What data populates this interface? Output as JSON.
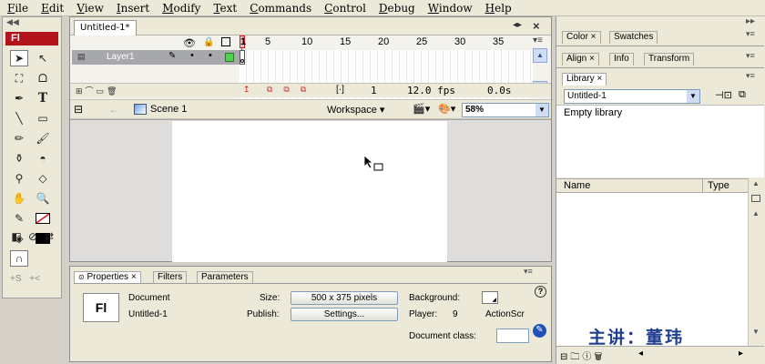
{
  "menubar": {
    "items": [
      "File",
      "Edit",
      "View",
      "Insert",
      "Modify",
      "Text",
      "Commands",
      "Control",
      "Debug",
      "Window",
      "Help"
    ]
  },
  "toolbox": {
    "logo": "Fl",
    "tool_icons": [
      "selection-arrow",
      "subselect-arrow",
      "free-transform",
      "lasso",
      "pen",
      "text",
      "line",
      "rectangle",
      "pencil",
      "brush",
      "ink-bottle",
      "paint-bucket",
      "eyedropper",
      "eraser",
      "hand",
      "zoom",
      "stroke-color",
      "fill-color",
      "black-white",
      "swap-colors",
      "snap-magnet"
    ],
    "snap_label": "+S",
    "arrow_label": "+<"
  },
  "document": {
    "tab_title": "Untitled-1*",
    "timeline": {
      "frame_numbers": [
        "1",
        "5",
        "10",
        "15",
        "20",
        "25",
        "30",
        "35"
      ],
      "layer_name": "Layer1",
      "current_frame": "1",
      "frame_rate": "12.0 fps",
      "elapsed": "0.0s",
      "brackets": "[·]"
    },
    "editbar": {
      "scene": "Scene 1",
      "workspace": "Workspace",
      "zoom": "58%"
    }
  },
  "properties": {
    "tabs": [
      "Properties",
      "Filters",
      "Parameters"
    ],
    "doc_icon_label": "Fl",
    "type_label": "Document",
    "doc_name": "Untitled-1",
    "size_label": "Size:",
    "size_value": "500 x 375 pixels",
    "publish_label": "Publish:",
    "settings_button": "Settings...",
    "background_label": "Background:",
    "player_label": "Player:",
    "player_value": "9",
    "actionscript_label": "ActionScr",
    "doc_class_label": "Document class:",
    "doc_class_value": "",
    "help_icon_label": "?"
  },
  "right_panels": {
    "color_tabs": [
      "Color",
      "Swatches"
    ],
    "align_tabs": [
      "Align",
      "Info",
      "Transform"
    ],
    "library_tab": "Library",
    "library_doc": "Untitled-1",
    "empty_text": "Empty library",
    "col_name": "Name",
    "col_type": "Type"
  },
  "watermark": "主讲：董玮",
  "colors": {
    "brand_red": "#b3131a",
    "layer_row": "#a7a8ab",
    "playhead": "#e0141e",
    "watermark": "#1f3e8f"
  }
}
